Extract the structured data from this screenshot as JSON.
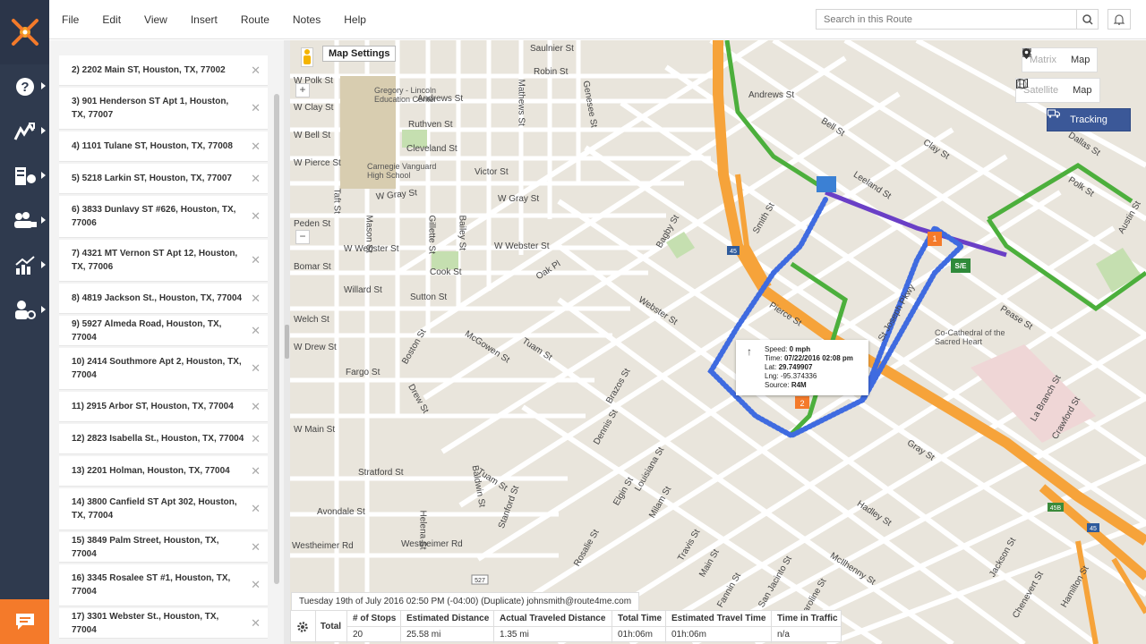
{
  "menu": [
    "File",
    "Edit",
    "View",
    "Insert",
    "Route",
    "Notes",
    "Help"
  ],
  "search": {
    "placeholder": "Search in this Route"
  },
  "rail_icons": [
    "help-icon",
    "routes-icon",
    "route-planner-icon",
    "team-icon",
    "analytics-icon",
    "settings-icon"
  ],
  "stops": [
    {
      "label": "2) 2202 Main ST, Houston, TX, 77002"
    },
    {
      "label": "3) 901 Henderson ST Apt 1, Houston, TX, 77007"
    },
    {
      "label": "4) 1101 Tulane ST, Houston, TX, 77008"
    },
    {
      "label": "5) 5218 Larkin ST, Houston, TX, 77007"
    },
    {
      "label": "6) 3833 Dunlavy ST #626, Houston, TX, 77006"
    },
    {
      "label": "7) 4321 MT Vernon ST Apt 12, Houston, TX, 77006"
    },
    {
      "label": "8) 4819 Jackson St., Houston, TX, 77004"
    },
    {
      "label": "9) 5927 Almeda Road, Houston, TX, 77004"
    },
    {
      "label": "10) 2414 Southmore Apt 2, Houston, TX, 77004"
    },
    {
      "label": "11) 2915 Arbor ST, Houston, TX, 77004"
    },
    {
      "label": "12) 2823 Isabella St., Houston, TX, 77004"
    },
    {
      "label": "13) 2201 Holman, Houston, TX, 77004"
    },
    {
      "label": "14) 3800 Canfield ST Apt 302, Houston, TX, 77004"
    },
    {
      "label": "15) 3849 Palm Street, Houston, TX, 77004"
    },
    {
      "label": "16) 3345 Rosalee ST #1, Houston, TX, 77004"
    },
    {
      "label": "17) 3301 Webster St., Houston, TX, 77004"
    }
  ],
  "map": {
    "settings_label": "Map Settings",
    "view_toggle": {
      "matrix": "Matrix",
      "map": "Map"
    },
    "layer_toggle": {
      "satellite": "Satellite",
      "map": "Map"
    },
    "tracking_label": "Tracking",
    "markers": {
      "start_end": "S/E",
      "stop_1": "1",
      "stop_2": "2"
    },
    "popup": {
      "speed_label": "Speed:",
      "speed": "0 mph",
      "time_label": "Time:",
      "time": "07/22/2016 02:08 pm",
      "lat_label": "Lat:",
      "lat": "29.749907",
      "lng_label": "Lng:",
      "lng": "-95.374336",
      "source_label": "Source:",
      "source": "R4M"
    },
    "streets": [
      "Saulnier St",
      "Robin St",
      "W Polk St",
      "Andrews St",
      "Ruthven St",
      "W Clay St",
      "Cleveland St",
      "W Bell St",
      "W Pierce St",
      "Victor St",
      "W Gray St",
      "W Gray St",
      "Peden St",
      "W Webster St",
      "W Webster St",
      "Bomar St",
      "Cook St",
      "Willard St",
      "Sutton St",
      "Welch St",
      "W Drew St",
      "Fargo St",
      "Stratford St",
      "Avondale St",
      "Westheimer Rd",
      "Westheimer Rd",
      "Taft St",
      "Mason St",
      "Gillette St",
      "Bailey St",
      "Mathews St",
      "Genesee St",
      "Bagby St",
      "Brazos St",
      "Smith St",
      "Louisiana St",
      "Milam St",
      "Travis St",
      "Main St",
      "Fannin St",
      "San Jacinto St",
      "Caroline St",
      "La Branch St",
      "Crawford St",
      "Jackson St",
      "Chenevert St",
      "Hamilton St",
      "McGowen St",
      "Tuam St",
      "Webster St",
      "Hadley St",
      "McIlhenny St",
      "Pierce St",
      "Gray St",
      "Andrews St",
      "Bell St",
      "Leeland St",
      "Clay St",
      "Polk St",
      "Dallas St",
      "Pease St",
      "Austin St",
      "St Joseph Pkwy",
      "Oak Pl",
      "Drew St",
      "Baldwin St",
      "Helena St",
      "Boston St",
      "Stanford St",
      "Rosalie St",
      "Dennis St",
      "Elgin St",
      "W Main St",
      "Tuam St"
    ],
    "pois": [
      "Gregory - Lincoln Education Center",
      "Carnegie Vanguard High School",
      "Co-Cathedral of the Sacred Heart"
    ],
    "highway_shields": [
      "45",
      "45",
      "45B",
      "527"
    ]
  },
  "route": {
    "title": "Tuesday 19th of July 2016 02:50 PM (-04:00) (Duplicate) johnsmith@route4me.com",
    "total_label": "Total",
    "columns": [
      {
        "header": "# of Stops",
        "value": "20"
      },
      {
        "header": "Estimated Distance",
        "value": "25.58 mi"
      },
      {
        "header": "Actual Traveled Distance",
        "value": "1.35 mi"
      },
      {
        "header": "Total Time",
        "value": "01h:06m"
      },
      {
        "header": "Estimated Travel Time",
        "value": "01h:06m"
      },
      {
        "header": "Time in Traffic",
        "value": "n/a"
      }
    ]
  },
  "colors": {
    "rail_bg": "#2f3a4e",
    "accent_orange": "#f47a2a",
    "tracking_blue": "#3b5898",
    "highway": "#f6a33a",
    "route_green": "#4caf3c",
    "track_blue": "#3f6be0",
    "route_purple": "#6a3fc6"
  }
}
